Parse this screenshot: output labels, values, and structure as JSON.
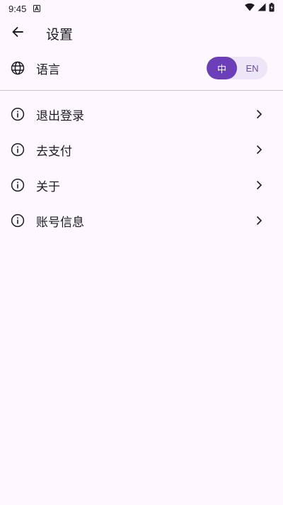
{
  "status_bar": {
    "time": "9:45",
    "icons": [
      "app-notification-icon",
      "wifi-icon",
      "signal-icon",
      "battery-icon"
    ]
  },
  "header": {
    "title": "设置",
    "back_icon": "arrow-back-icon"
  },
  "language": {
    "label": "语言",
    "icon": "globe-icon",
    "options": [
      "中",
      "EN"
    ],
    "selected": "中"
  },
  "menu": {
    "items": [
      {
        "label": "退出登录",
        "icon": "info-icon"
      },
      {
        "label": "去支付",
        "icon": "info-icon"
      },
      {
        "label": "关于",
        "icon": "info-icon"
      },
      {
        "label": "账号信息",
        "icon": "info-icon"
      }
    ]
  },
  "colors": {
    "background": "#fdf7fe",
    "accent": "#6a3fb8",
    "toggle_track": "#ece6f7",
    "text": "#1d1b20",
    "divider": "#c9c3cf"
  }
}
